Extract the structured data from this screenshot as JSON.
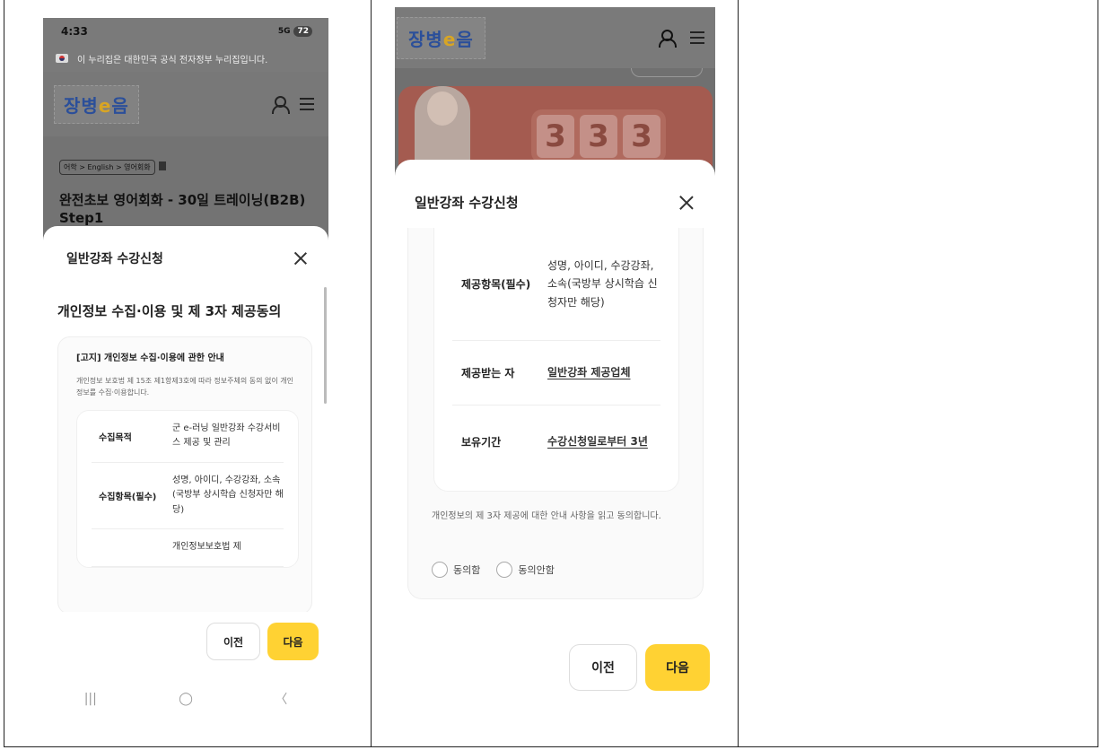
{
  "left_phone": {
    "status_bar": {
      "time": "4:33",
      "battery": "72",
      "network": "5G"
    },
    "gov_banner": "이 누리집은 대한민국 공식 전자정부 누리집입니다.",
    "logo": {
      "text_main": "장병",
      "text_e": "e",
      "text_end": "음"
    },
    "breadcrumb": "어학 > English > 영어회화",
    "course_title": "완전초보 영어회화 - 30일 트레이닝(B2B) Step1",
    "modal_title": "일반강좌 수강신청",
    "section_title": "개인정보 수집·이용 및 제 3자 제공동의",
    "notice_title": "[고지] 개인정보 수집·이용에 관한 안내",
    "notice_desc": "개인정보 보호법 제 15조 제1항제3호에 따라 정보주체의 동의 없이 개인정보를 수집·이용합니다.",
    "rows": [
      {
        "key": "수집목적",
        "value": "군 e-러닝 일반강좌 수강서비스 제공 및 관리"
      },
      {
        "key": "수집항목(필수)",
        "value": "성명, 아이디, 수강강좌, 소속(국방부 상시학습 신청자만 해당)"
      },
      {
        "key": "",
        "value": "개인정보보호법 제"
      }
    ],
    "prev_label": "이전",
    "next_label": "다음",
    "nav": {
      "recent": "|||",
      "home": "◯",
      "back": "〈"
    }
  },
  "right_phone": {
    "logo": {
      "text_main": "장병",
      "text_e": "e",
      "text_end": "음"
    },
    "banner_digits": [
      "3",
      "3",
      "3"
    ],
    "modal_title": "일반강좌 수강신청",
    "rows": [
      {
        "key": "제공항목(필수)",
        "value": "성명, 아이디, 수강강좌, 소속(국방부 상시학습 신청자만 해당)"
      },
      {
        "key": "제공받는 자",
        "value": "일반강좌 제공업체"
      },
      {
        "key": "보유기간",
        "value": "수강신청일로부터 3년"
      }
    ],
    "agree_text": "개인정보의 제 3자 제공에 대한 안내 사항을 읽고 동의합니다.",
    "agree_label": "동의함",
    "disagree_label": "동의안함",
    "prev_label": "이전",
    "next_label": "다음"
  },
  "colors": {
    "accent": "#ffd233",
    "overlay": "#6f6f6f"
  }
}
